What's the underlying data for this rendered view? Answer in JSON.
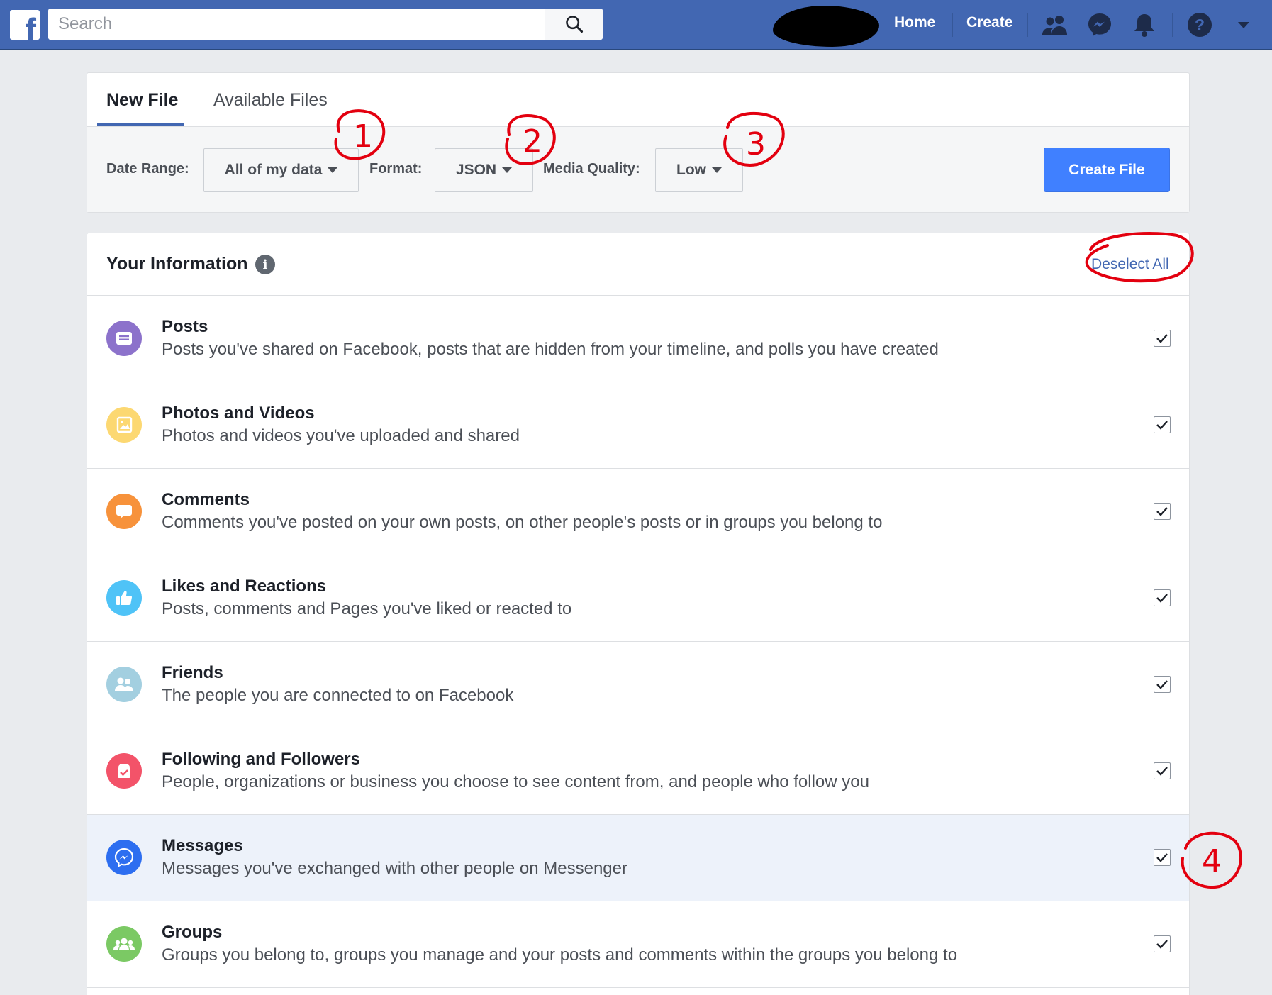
{
  "topbar": {
    "search_placeholder": "Search",
    "nav": {
      "home": "Home",
      "create": "Create"
    },
    "icons": [
      "friends-icon",
      "messenger-icon",
      "notifications-icon",
      "help-icon",
      "account-menu-icon"
    ]
  },
  "tabs": [
    {
      "label": "New File",
      "active": true
    },
    {
      "label": "Available Files",
      "active": false
    }
  ],
  "controls": {
    "date_range_label": "Date Range:",
    "date_range_value": "All of my data",
    "format_label": "Format:",
    "format_value": "JSON",
    "media_quality_label": "Media Quality:",
    "media_quality_value": "Low",
    "create_button": "Create File"
  },
  "info": {
    "title": "Your Information",
    "deselect_all": "Deselect All",
    "items": [
      {
        "title": "Posts",
        "desc": "Posts you've shared on Facebook, posts that are hidden from your timeline, and polls you have created",
        "icon": "posts-icon",
        "color": "#8c72cb",
        "checked": true
      },
      {
        "title": "Photos and Videos",
        "desc": "Photos and videos you've uploaded and shared",
        "icon": "photos-icon",
        "color": "#fcd872",
        "checked": true
      },
      {
        "title": "Comments",
        "desc": "Comments you've posted on your own posts, on other people's posts or in groups you belong to",
        "icon": "comment-icon",
        "color": "#f7923b",
        "checked": true
      },
      {
        "title": "Likes and Reactions",
        "desc": "Posts, comments and Pages you've liked or reacted to",
        "icon": "thumbs-up-icon",
        "color": "#4fc3f7",
        "checked": true
      },
      {
        "title": "Friends",
        "desc": "The people you are connected to on Facebook",
        "icon": "friends-icon",
        "color": "#a3cfe0",
        "checked": true
      },
      {
        "title": "Following and Followers",
        "desc": "People, organizations or business you choose to see content from, and people who follow you",
        "icon": "following-icon",
        "color": "#f35369",
        "checked": true
      },
      {
        "title": "Messages",
        "desc": "Messages you've exchanged with other people on Messenger",
        "icon": "messenger-icon",
        "color": "#2d6ef0",
        "checked": true,
        "highlighted": true
      },
      {
        "title": "Groups",
        "desc": "Groups you belong to, groups you manage and your posts and comments within the groups you belong to",
        "icon": "groups-icon",
        "color": "#7bc964",
        "checked": true
      }
    ]
  },
  "annotations": [
    "1",
    "2",
    "3",
    "4"
  ],
  "colors": {
    "brand": "#4267b2",
    "button": "#4080ff",
    "annotation": "#e3000f"
  }
}
